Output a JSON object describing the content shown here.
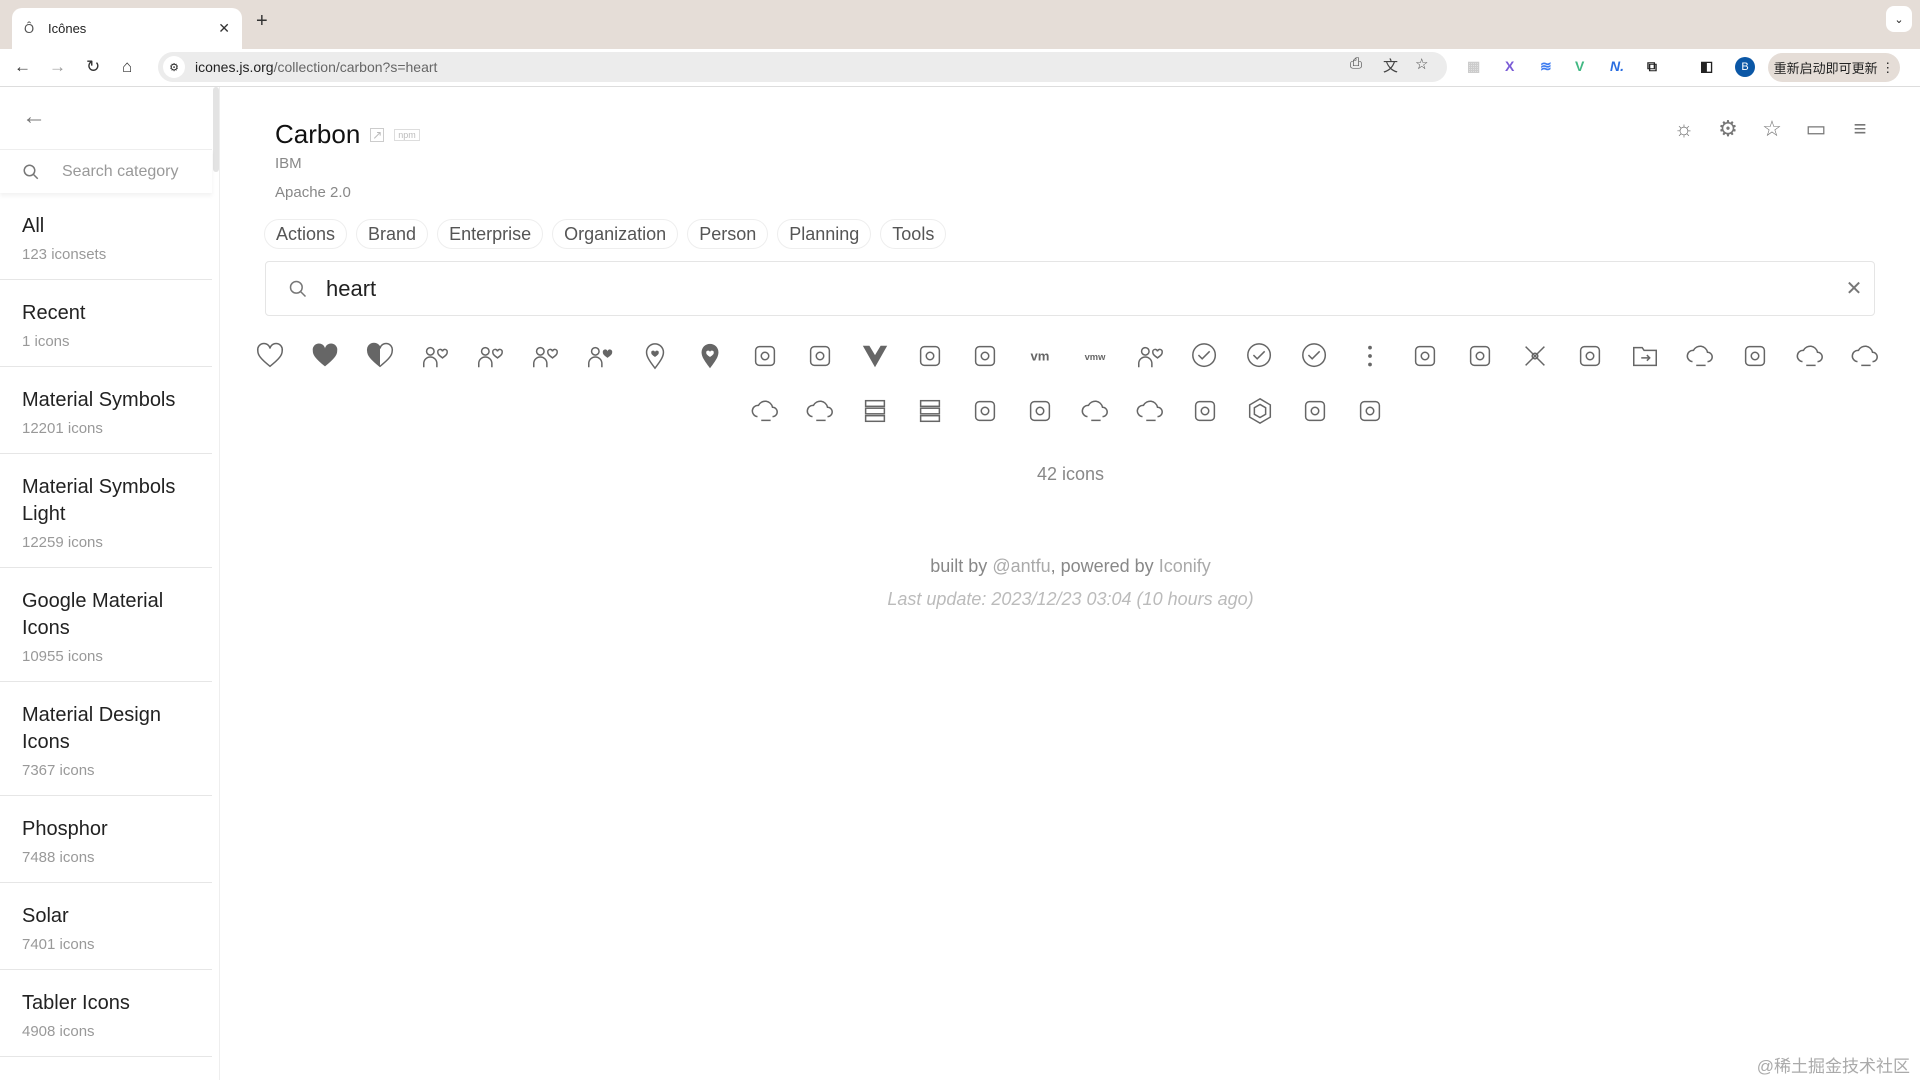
{
  "browser": {
    "tab_title": "Icônes",
    "url_host": "icones.js.org",
    "url_path": "/collection/carbon?s=heart",
    "update_label": "重新启动即可更新",
    "profile_initial": "B"
  },
  "sidebar": {
    "search_placeholder": "Search category",
    "items": [
      {
        "name": "All",
        "count": "123 iconsets"
      },
      {
        "name": "Recent",
        "count": "1 icons"
      },
      {
        "name": "Material Symbols",
        "count": "12201 icons"
      },
      {
        "name": "Material Symbols Light",
        "count": "12259 icons"
      },
      {
        "name": "Google Material Icons",
        "count": "10955 icons"
      },
      {
        "name": "Material Design Icons",
        "count": "7367 icons"
      },
      {
        "name": "Phosphor",
        "count": "7488 icons"
      },
      {
        "name": "Solar",
        "count": "7401 icons"
      },
      {
        "name": "Tabler Icons",
        "count": "4908 icons"
      }
    ]
  },
  "collection": {
    "title": "Carbon",
    "npm_label": "npm",
    "author": "IBM",
    "license": "Apache 2.0",
    "tags": [
      "Actions",
      "Brand",
      "Enterprise",
      "Organization",
      "Person",
      "Planning",
      "Tools"
    ]
  },
  "search": {
    "value": "heart"
  },
  "icons": [
    "favorite",
    "favorite-filled",
    "favorite-half",
    "person-favorite",
    "user-favorite",
    "user-favorite-alt",
    "user-favorite-alt-filled",
    "location-heart",
    "location-heart-filled",
    "train-heart",
    "watson-health-cross-reference",
    "logo-vue",
    "logo-svelte",
    "logo-openshift",
    "logo-vmware",
    "logo-vmware-alt",
    "cursor-user",
    "checkmark-outline",
    "checkmark-outline-error",
    "checkmark-outline-warning",
    "overflow-menu-vertical",
    "data-connected",
    "chart-error-bar",
    "network",
    "ibm-cloud-pak-integration",
    "folder-move-to",
    "cloud-alerting",
    "filter-remove",
    "cloud-upload",
    "cloud-service-management",
    "cloud-monitoring",
    "cloud-services",
    "ibm-cloud-direct-link",
    "server-proxy",
    "ibm-cloud-transit-gateway",
    "ibm-cloud-vpc-client-vpn",
    "weather-thunder",
    "cloud-data-ops",
    "ibm-cloud-key-protect",
    "hexagon-outline",
    "ibm-cloud-dedicated-host",
    "password"
  ],
  "count_label": "42 icons",
  "footer": {
    "built_by": "built by ",
    "author_link": "@antfu",
    "powered_by": ", powered by ",
    "iconify_link": "Iconify",
    "last_update": "Last update: 2023/12/23 03:04 (10 hours ago)"
  },
  "watermark": "@稀土掘金技术社区",
  "colors": {
    "icon": "#666666",
    "tab_strip": "#e5ddd7",
    "muted_text": "#888888"
  }
}
